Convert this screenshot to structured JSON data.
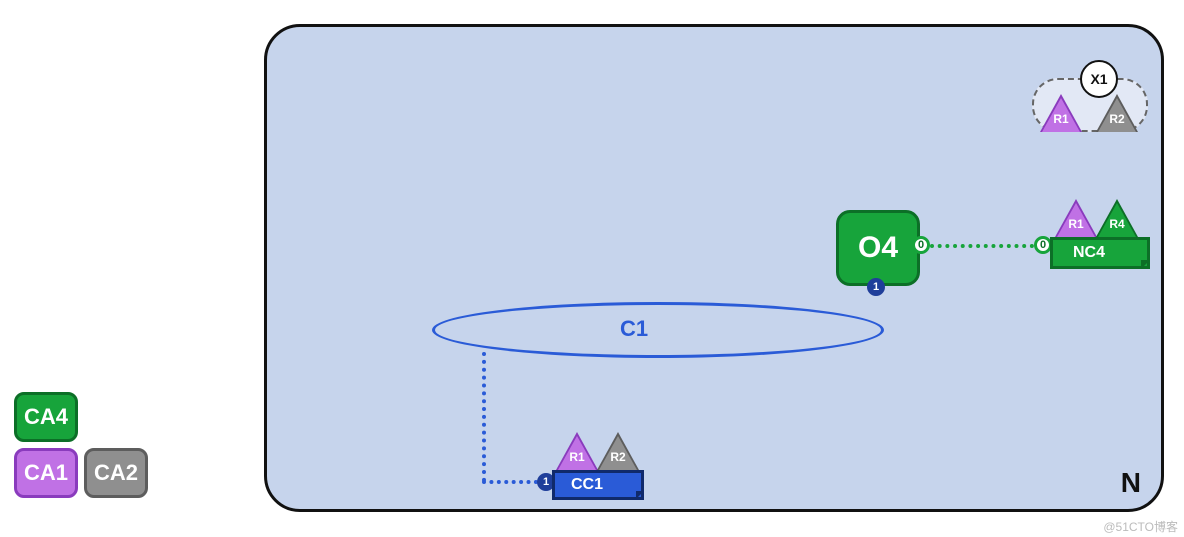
{
  "container": {
    "label": "N"
  },
  "ellipse": {
    "label": "C1"
  },
  "nodes": {
    "o4": {
      "label": "O4",
      "ports": {
        "right": "0",
        "bottom": "1"
      }
    },
    "nc4": {
      "label": "NC4",
      "port_left": "0",
      "triangles": [
        "R1",
        "R4"
      ]
    },
    "cc1": {
      "label": "CC1",
      "port_left": "1",
      "triangles": [
        "R1",
        "R2"
      ]
    },
    "x1": {
      "label": "X1",
      "triangles": [
        "R1",
        "R2"
      ]
    }
  },
  "left_boxes": {
    "ca4": "CA4",
    "ca1": "CA1",
    "ca2": "CA2"
  },
  "watermark": "@51CTO博客"
}
